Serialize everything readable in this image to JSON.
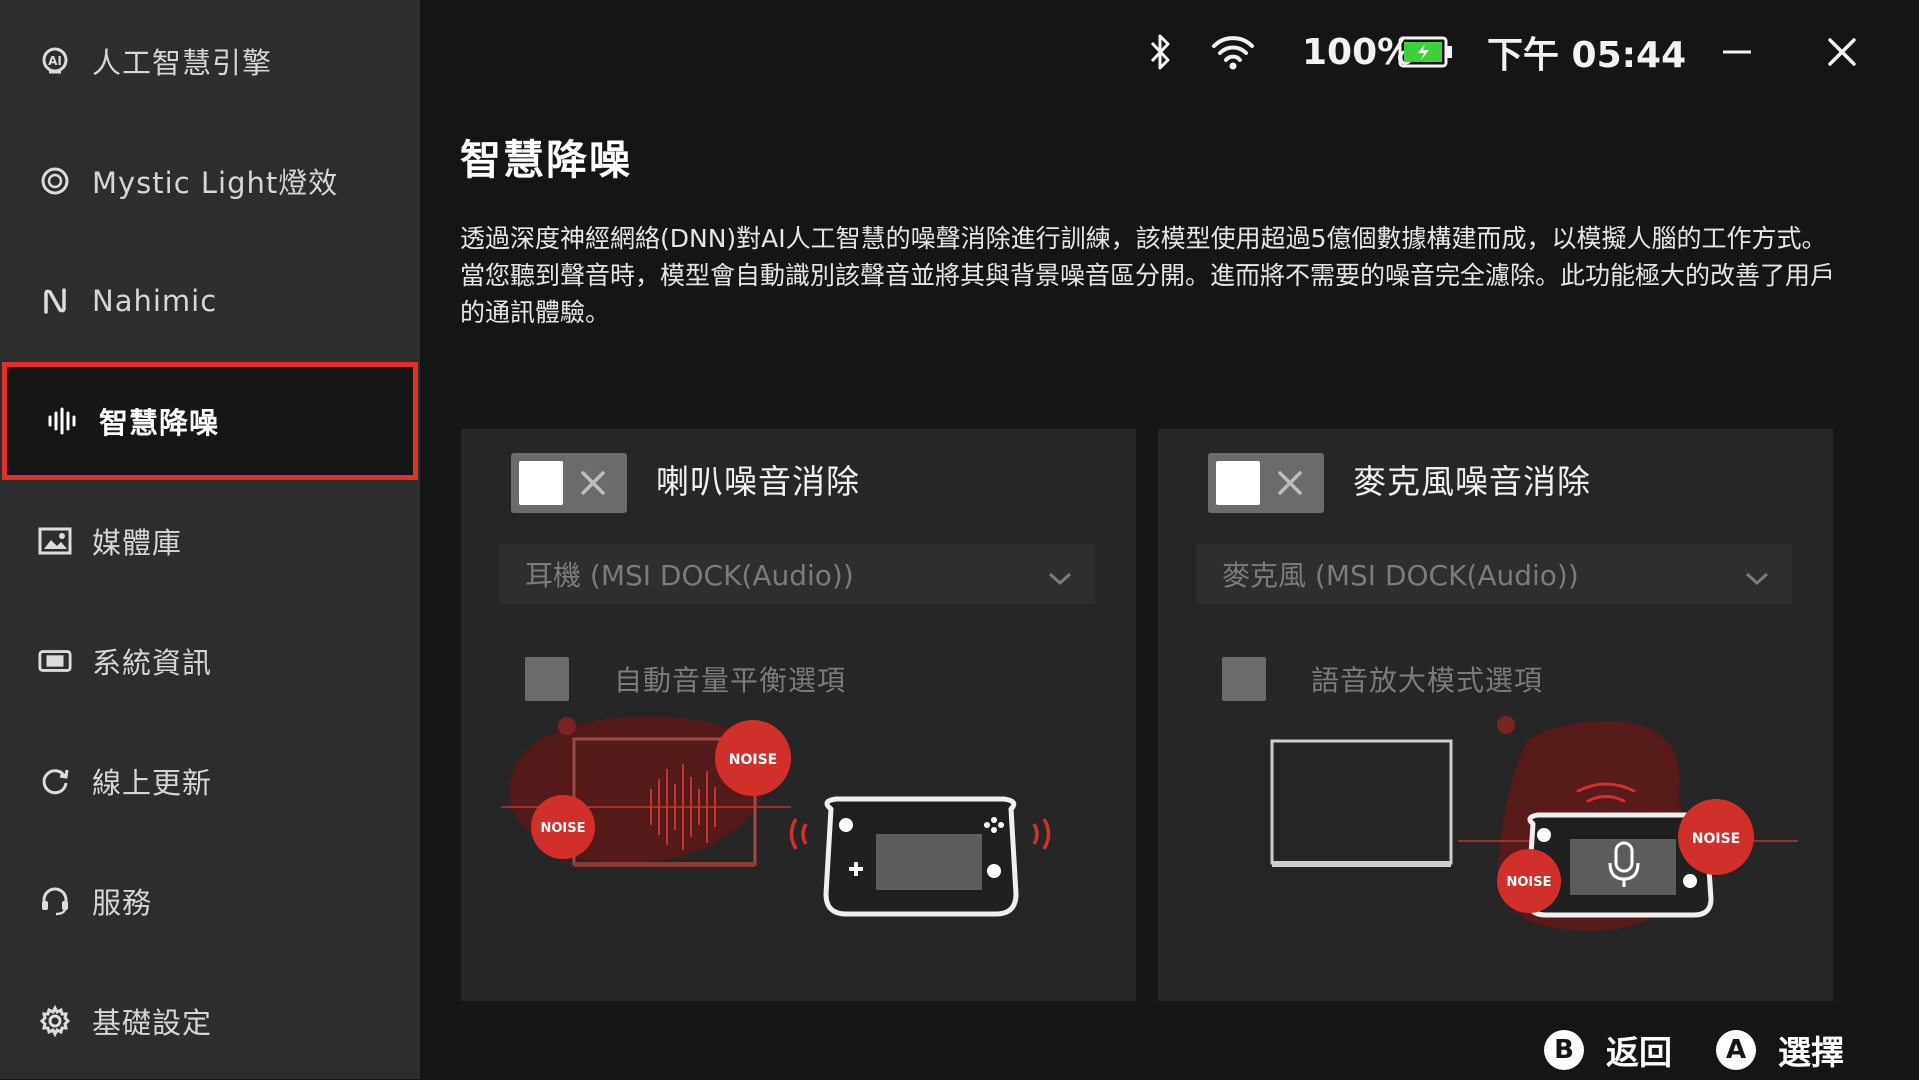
{
  "sidebar": {
    "items": [
      {
        "label": "人工智慧引擎",
        "icon": "ai-engine-icon"
      },
      {
        "label": "Mystic Light燈效",
        "icon": "mystic-light-icon"
      },
      {
        "label": "Nahimic",
        "icon": "nahimic-icon"
      },
      {
        "label": "智慧降噪",
        "icon": "noise-cancel-icon",
        "active": true
      },
      {
        "label": "媒體庫",
        "icon": "image-icon"
      },
      {
        "label": "系統資訊",
        "icon": "system-info-icon"
      },
      {
        "label": "線上更新",
        "icon": "update-icon"
      },
      {
        "label": "服務",
        "icon": "headset-icon"
      },
      {
        "label": "基礎設定",
        "icon": "gear-icon"
      }
    ]
  },
  "topbar": {
    "battery": "100%",
    "time": "下午 05:44"
  },
  "main": {
    "title": "智慧降噪",
    "description": "透過深度神經網絡(DNN)對AI人工智慧的噪聲消除進行訓練，該模型使用超過5億個數據構建而成，以模擬人腦的工作方式。當您聽到聲音時，模型會自動識別該聲音並將其與背景噪音區分開。進而將不需要的噪音完全濾除。此功能極大的改善了用戶的通訊體驗。",
    "cards": [
      {
        "title": "喇叭噪音消除",
        "toggle_on": false,
        "device": "耳機 (MSI DOCK(Audio))",
        "option": "自動音量平衡選項",
        "noise_a": "NOISE",
        "noise_b": "NOISE"
      },
      {
        "title": "麥克風噪音消除",
        "toggle_on": false,
        "device": "麥克風 (MSI DOCK(Audio))",
        "option": "語音放大模式選項",
        "noise_a": "NOISE",
        "noise_b": "NOISE"
      }
    ]
  },
  "footer": {
    "back_key": "B",
    "back_label": "返回",
    "select_key": "A",
    "select_label": "選擇"
  },
  "colors": {
    "accent": "#e0322b",
    "sidebar_bg": "#2d2d2d",
    "content_bg": "#151515",
    "card_bg": "#262626",
    "battery_green": "#3fd13a"
  }
}
